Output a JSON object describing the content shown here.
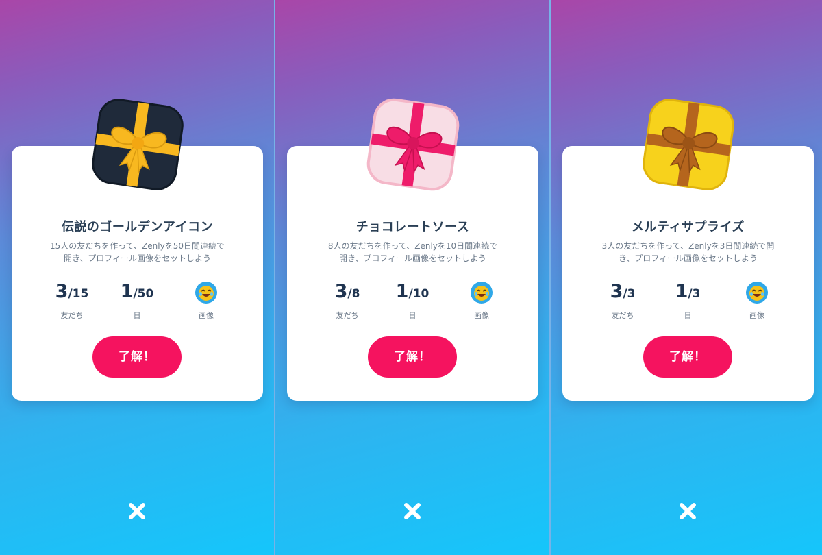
{
  "screens": [
    {
      "title": "伝説のゴールデンアイコン",
      "description_line1": "15人の友だちを作って、Zenlyを50日間連続で",
      "description_line2": "開き、プロフィール画像をセットしよう",
      "friends": {
        "current": "3",
        "total": "/15",
        "label": "友だち"
      },
      "days": {
        "current": "1",
        "total": "/50",
        "label": "日"
      },
      "image": {
        "label": "画像",
        "icon": "laughing-emoji-icon"
      },
      "ok_button": "了解！",
      "gift": {
        "box_color": "#1f2a3a",
        "ribbon_color": "#f8b820",
        "icon": "gift-box-icon"
      }
    },
    {
      "title": "チョコレートソース",
      "description_line1": "8人の友だちを作って、Zenlyを10日間連続で",
      "description_line2": "開き、プロフィール画像をセットしよう",
      "friends": {
        "current": "3",
        "total": "/8",
        "label": "友だち"
      },
      "days": {
        "current": "1",
        "total": "/10",
        "label": "日"
      },
      "image": {
        "label": "画像",
        "icon": "laughing-emoji-icon"
      },
      "ok_button": "了解！",
      "gift": {
        "box_color": "#f8dde5",
        "ribbon_color": "#ee1c6a",
        "icon": "gift-box-icon"
      }
    },
    {
      "title": "メルティサプライズ",
      "description_line1": "3人の友だちを作って、Zenlyを3日間連続で開",
      "description_line2": "き、プロフィール画像をセットしよう",
      "friends": {
        "current": "3",
        "total": "/3",
        "label": "友だち"
      },
      "days": {
        "current": "1",
        "total": "/3",
        "label": "日"
      },
      "image": {
        "label": "画像",
        "icon": "laughing-emoji-icon"
      },
      "ok_button": "了解！",
      "gift": {
        "box_color": "#f7d21c",
        "ribbon_color": "#b5651d",
        "icon": "gift-box-icon"
      }
    }
  ],
  "close_icon": "close-icon",
  "colors": {
    "button": "#f5135f",
    "text_dark": "#1f3450",
    "text_muted": "#6c7a8a",
    "card": "#ffffff"
  }
}
